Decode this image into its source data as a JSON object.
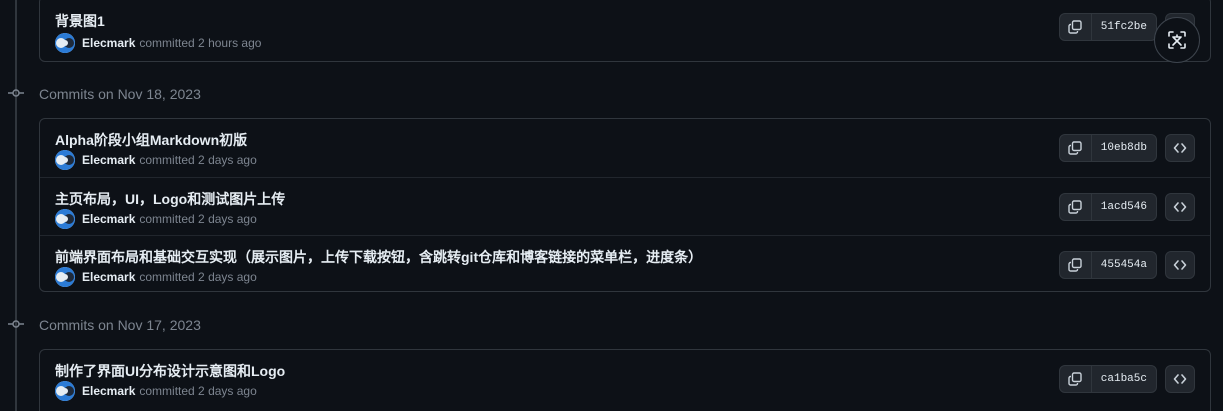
{
  "top_commit": {
    "title": "背景图1",
    "author": "Elecmark",
    "committed": "committed 2 hours ago",
    "sha": "51fc2be"
  },
  "groups": [
    {
      "header": "Commits on Nov 18, 2023",
      "commits": [
        {
          "title": "Alpha阶段小组Markdown初版",
          "author": "Elecmark",
          "committed": "committed 2 days ago",
          "sha": "10eb8db"
        },
        {
          "title": "主页布局，UI，Logo和测试图片上传",
          "author": "Elecmark",
          "committed": "committed 2 days ago",
          "sha": "1acd546"
        },
        {
          "title": "前端界面布局和基础交互实现（展示图片，上传下载按钮，含跳转git仓库和博客链接的菜单栏，进度条）",
          "author": "Elecmark",
          "committed": "committed 2 days ago",
          "sha": "455454a"
        }
      ]
    },
    {
      "header": "Commits on Nov 17, 2023",
      "commits": [
        {
          "title": "制作了界面UI分布设计示意图和Logo",
          "author": "Elecmark",
          "committed": "committed 2 days ago",
          "sha": "ca1ba5c"
        }
      ]
    }
  ],
  "icons": {
    "copy": "copy-icon",
    "browse": "code-icon",
    "commit": "git-commit-icon",
    "translate": "translate-icon"
  },
  "colors": {
    "background": "#0d1117",
    "border": "#30363d",
    "muted_text": "#7d8590",
    "primary_text": "#e6edf3"
  }
}
